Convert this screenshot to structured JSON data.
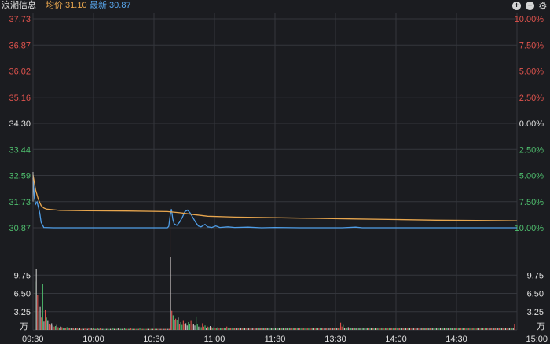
{
  "header": {
    "stock_name": "浪潮信息",
    "avg_label": "均价:31.10",
    "last_label": "最新:30.87",
    "zoom_in": "+",
    "zoom_out": "−",
    "settings_icon": "gear-icon"
  },
  "colors": {
    "background": "#1b1c20",
    "grid": "#34363c",
    "up": "#e0534d",
    "down": "#4fbf6e",
    "neutral": "#e0e0e0",
    "price_line": "#4f9ee8",
    "avg_line": "#e8a64e",
    "volume_neutral": "#c8c8c8"
  },
  "chart_data": [
    {
      "type": "line",
      "name": "intraday-price",
      "x_ticks": [
        "09:30",
        "10:00",
        "10:30",
        "11:00",
        "11:30",
        "13:30",
        "14:00",
        "14:30",
        "15:00"
      ],
      "y_ticks_left": [
        "37.73",
        "36.87",
        "36.02",
        "35.16",
        "34.30",
        "33.44",
        "32.59",
        "31.73",
        "30.87"
      ],
      "y_ticks_right": [
        "10.00%",
        "7.50%",
        "5.00%",
        "2.50%",
        "0.00%",
        "2.50%",
        "5.00%",
        "7.50%",
        "10.00%"
      ],
      "ylim": [
        30.87,
        37.73
      ],
      "reference_price": 34.3,
      "series": [
        {
          "key": "price",
          "points": [
            [
              0,
              32.5
            ],
            [
              1,
              31.85
            ],
            [
              2,
              31.65
            ],
            [
              3,
              31.72
            ],
            [
              4,
              31.55
            ],
            [
              5,
              31.35
            ],
            [
              6,
              31.05
            ],
            [
              8,
              30.88
            ],
            [
              15,
              30.87
            ],
            [
              30,
              30.87
            ],
            [
              60,
              30.87
            ],
            [
              90,
              30.87
            ],
            [
              100,
              30.87
            ],
            [
              101,
              30.92
            ],
            [
              102,
              31.25
            ],
            [
              103,
              31.48
            ],
            [
              104,
              31.15
            ],
            [
              105,
              31.0
            ],
            [
              107,
              30.95
            ],
            [
              109,
              31.05
            ],
            [
              111,
              31.2
            ],
            [
              113,
              31.4
            ],
            [
              115,
              31.45
            ],
            [
              117,
              31.35
            ],
            [
              119,
              31.2
            ],
            [
              121,
              31.05
            ],
            [
              123,
              30.93
            ],
            [
              125,
              30.9
            ],
            [
              128,
              30.98
            ],
            [
              130,
              30.9
            ],
            [
              133,
              30.88
            ],
            [
              136,
              30.93
            ],
            [
              139,
              30.88
            ],
            [
              145,
              30.9
            ],
            [
              150,
              30.88
            ],
            [
              160,
              30.89
            ],
            [
              170,
              30.87
            ],
            [
              180,
              30.88
            ],
            [
              200,
              30.87
            ],
            [
              230,
              30.87
            ],
            [
              240,
              30.89
            ],
            [
              245,
              30.87
            ],
            [
              270,
              30.87
            ],
            [
              300,
              30.87
            ],
            [
              330,
              30.87
            ],
            [
              360,
              30.87
            ]
          ]
        },
        {
          "key": "avg",
          "points": [
            [
              0,
              32.6
            ],
            [
              2,
              32.1
            ],
            [
              4,
              31.8
            ],
            [
              6,
              31.6
            ],
            [
              8,
              31.52
            ],
            [
              10,
              31.48
            ],
            [
              20,
              31.44
            ],
            [
              40,
              31.43
            ],
            [
              70,
              31.42
            ],
            [
              100,
              31.4
            ],
            [
              110,
              31.36
            ],
            [
              120,
              31.3
            ],
            [
              130,
              31.25
            ],
            [
              150,
              31.22
            ],
            [
              180,
              31.2
            ],
            [
              210,
              31.18
            ],
            [
              240,
              31.16
            ],
            [
              270,
              31.14
            ],
            [
              300,
              31.12
            ],
            [
              330,
              31.11
            ],
            [
              360,
              31.1
            ]
          ]
        }
      ]
    },
    {
      "type": "bar",
      "name": "volume",
      "unit": "万",
      "y_ticks_left": [
        "9.75",
        "6.50",
        "3.25"
      ],
      "y_ticks_right": [
        "9.75",
        "6.50",
        "3.25"
      ],
      "ylim": [
        0,
        13.0
      ],
      "values": [
        8.6,
        10.8,
        6.2,
        3.2,
        4.1,
        2.2,
        8.2,
        1.5,
        3.5,
        2.2,
        1.6,
        1.1,
        0.9,
        1.2,
        0.8,
        0.6,
        0.7,
        0.9,
        0.5,
        0.4,
        0.6,
        0.5,
        0.4,
        0.3,
        0.4,
        0.5,
        0.3,
        0.4,
        0.3,
        0.4,
        0.3,
        0.2,
        0.4,
        0.3,
        0.2,
        0.3,
        0.2,
        0.3,
        0.2,
        0.3,
        0.4,
        0.2,
        0.3,
        0.2,
        0.3,
        0.2,
        0.3,
        0.2,
        0.2,
        0.3,
        0.2,
        0.3,
        0.2,
        0.2,
        0.3,
        0.2,
        0.2,
        0.3,
        0.2,
        0.2,
        0.2,
        0.3,
        0.2,
        0.2,
        0.2,
        0.3,
        0.2,
        0.2,
        0.2,
        0.2,
        0.3,
        0.2,
        0.2,
        0.2,
        0.2,
        0.3,
        0.2,
        0.2,
        0.2,
        0.2,
        0.2,
        0.2,
        0.3,
        0.2,
        0.2,
        0.2,
        0.2,
        0.2,
        0.2,
        0.2,
        0.2,
        0.2,
        0.2,
        0.2,
        0.2,
        0.2,
        0.2,
        0.3,
        0.2,
        0.2,
        0.2,
        0.2,
        0.2,
        0.2,
        0.2,
        0.2,
        13.0,
        3.4,
        2.6,
        1.8,
        2.0,
        1.7,
        2.2,
        1.1,
        1.4,
        0.9,
        1.6,
        1.0,
        1.2,
        0.8,
        1.4,
        1.0,
        1.6,
        0.9,
        1.1,
        0.8,
        2.4,
        1.0,
        0.6,
        0.8,
        0.5,
        1.2,
        0.6,
        0.8,
        0.4,
        0.6,
        0.5,
        0.7,
        0.5,
        0.4,
        0.6,
        0.4,
        0.3,
        0.5,
        0.4,
        0.3,
        0.4,
        0.3,
        0.4,
        0.3,
        0.6,
        0.4,
        0.3,
        0.4,
        0.3,
        0.3,
        0.4,
        0.3,
        0.3,
        0.4,
        0.3,
        0.3,
        0.3,
        0.4,
        0.3,
        0.3,
        0.3,
        0.3,
        0.4,
        0.3,
        0.3,
        0.3,
        0.3,
        0.3,
        0.3,
        0.3,
        0.3,
        0.3,
        0.3,
        0.3,
        0.3,
        0.3,
        0.3,
        0.3,
        0.3,
        0.3,
        0.3,
        0.3,
        0.3,
        0.3,
        0.3,
        0.3,
        0.3,
        0.3,
        0.3,
        0.3,
        0.3,
        0.3,
        0.3,
        0.3,
        0.3,
        0.3,
        0.3,
        0.3,
        0.3,
        0.3,
        0.3,
        0.3,
        0.3,
        0.3,
        0.3,
        0.3,
        0.3,
        0.3,
        0.3,
        0.3,
        0.3,
        0.3,
        0.3,
        0.3,
        0.3,
        0.3,
        0.3,
        0.3,
        0.3,
        0.3,
        0.3,
        0.3,
        0.3,
        0.3,
        0.3,
        0.3,
        0.3,
        0.3,
        0.3,
        0.3,
        0.3,
        0.3,
        0.3,
        1.3,
        0.6,
        0.9,
        0.4,
        0.3,
        0.3,
        0.5,
        0.3,
        0.3,
        0.4,
        0.3,
        0.3,
        0.3,
        0.3,
        0.3,
        0.3,
        0.3,
        0.3,
        0.3,
        0.3,
        0.3,
        0.3,
        0.3,
        0.3,
        0.3,
        0.3,
        0.3,
        0.3,
        0.3,
        0.3,
        0.3,
        0.3,
        0.3,
        0.3,
        0.3,
        0.3,
        0.3,
        0.3,
        0.3,
        0.3,
        0.3,
        0.3,
        0.3,
        0.3,
        0.3,
        0.3,
        0.3,
        0.3,
        0.3,
        0.3,
        0.3,
        0.3,
        0.3,
        0.3,
        0.3,
        0.3,
        0.3,
        0.3,
        0.3,
        0.3,
        0.3,
        0.3,
        0.3,
        0.3,
        0.3,
        0.3,
        0.3,
        0.3,
        0.3,
        0.3,
        0.3,
        0.3,
        0.3,
        0.3,
        0.3,
        0.3,
        0.3,
        0.3,
        0.3,
        0.3,
        0.3,
        0.3,
        0.3,
        0.3,
        0.3,
        0.3,
        0.3,
        0.3,
        0.3,
        0.3,
        0.3,
        0.3,
        0.3,
        0.3,
        0.3,
        0.3,
        0.3,
        0.3,
        0.3,
        0.3,
        0.3,
        0.3,
        0.3,
        0.3,
        0.3,
        0.3,
        0.3,
        0.3,
        0.3,
        0.3,
        0.3,
        0.3,
        0.3,
        0.3,
        0.3,
        0.3,
        0.3,
        0.3,
        0.3,
        0.3,
        0.3,
        0.3,
        0.3,
        0.3,
        0.3,
        0.3,
        0.3,
        0.3,
        0.3,
        0.3,
        0.3,
        0.3,
        0.3,
        0.3,
        0.3,
        0.3,
        1.0
      ]
    }
  ]
}
